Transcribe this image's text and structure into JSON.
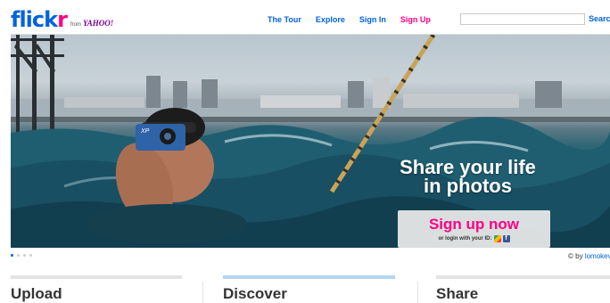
{
  "logo": {
    "flick": "flick",
    "r": "r",
    "from": "from",
    "yahoo": "YAHOO!"
  },
  "nav": [
    {
      "label": "The Tour",
      "color": "#0063dc"
    },
    {
      "label": "Explore",
      "color": "#0063dc"
    },
    {
      "label": "Sign In",
      "color": "#0063dc"
    },
    {
      "label": "Sign Up",
      "color": "#ff0084"
    }
  ],
  "search": {
    "placeholder": "",
    "button": "Search"
  },
  "hero": {
    "headline_line1": "Share your life",
    "headline_line2": "in photos",
    "signup_label": "Sign up now",
    "login_text": "or login with your ID:",
    "id_icons": [
      "google-icon",
      "facebook-icon"
    ],
    "camera_label": "XP"
  },
  "carousel": {
    "total": 4,
    "active_index": 0
  },
  "credit": {
    "prefix": "© by",
    "author": "lomokev"
  },
  "sections": [
    {
      "title": "Upload",
      "active": false
    },
    {
      "title": "Discover",
      "active": true
    },
    {
      "title": "Share",
      "active": false
    }
  ],
  "colors": {
    "brand_blue": "#0063dc",
    "brand_pink": "#ff0084",
    "active_section_bar": "#b4d6f0"
  }
}
